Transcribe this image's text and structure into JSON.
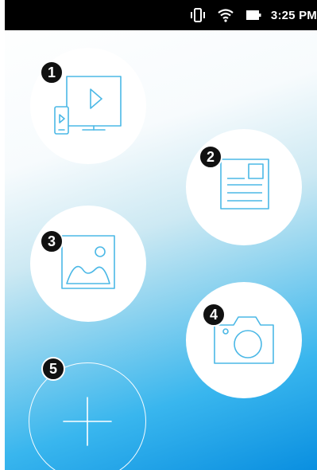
{
  "status_bar": {
    "time": "3:25 PM",
    "icons": [
      "vibrate-icon",
      "wifi-icon",
      "battery-icon"
    ]
  },
  "shortcuts": [
    {
      "badge": "1",
      "icon": "screen-cast-icon"
    },
    {
      "badge": "2",
      "icon": "document-icon"
    },
    {
      "badge": "3",
      "icon": "gallery-icon"
    },
    {
      "badge": "4",
      "icon": "camera-icon"
    },
    {
      "badge": "5",
      "icon": "add-icon"
    }
  ],
  "colors": {
    "icon_stroke": "#4bb8e6",
    "badge_bg": "#111111",
    "gradient_end": "#0a8fe0"
  }
}
